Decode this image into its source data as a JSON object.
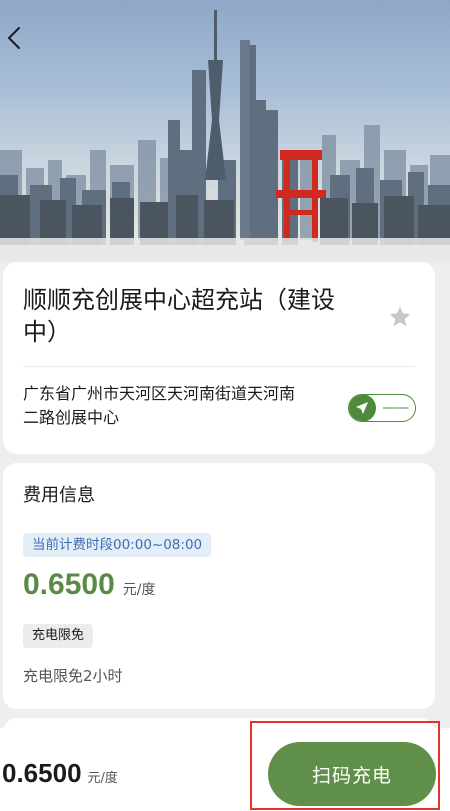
{
  "header": {
    "back_icon": "chevron-left-icon"
  },
  "station": {
    "title": "顺顺充创展中心超充站（建设中）",
    "address": "广东省广州市天河区天河南街道天河南二路创展中心",
    "favorite_icon": "star-icon",
    "navigation_icon": "navigation-arrow-icon",
    "distance": "——"
  },
  "fee": {
    "section_title": "费用信息",
    "period_label": "当前计费时段00:00~08:00",
    "price": "0.6500",
    "unit": "元/度",
    "free_tag": "充电限免",
    "free_desc": "充电限免2小时"
  },
  "bottom_bar": {
    "price": "0.6500",
    "unit": "元/度",
    "scan_button_label": "扫码充电"
  },
  "colors": {
    "accent_green": "#5f8f49",
    "price_green": "#5b8a44",
    "tag_blue_bg": "#e4eef8",
    "tag_blue_text": "#3d6fae",
    "highlight_red": "#e5332a"
  }
}
